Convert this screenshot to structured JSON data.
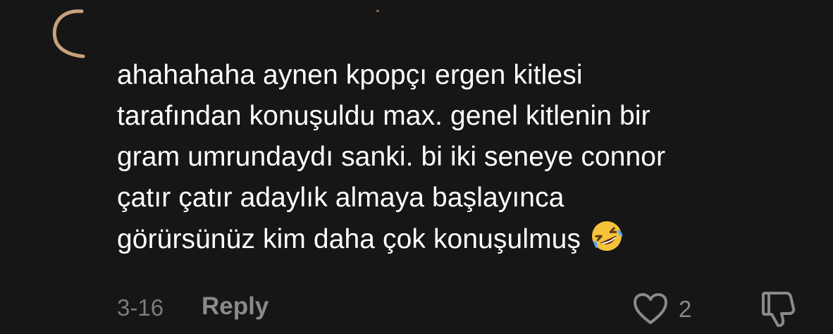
{
  "comment": {
    "lines": [
      "ahahahaha aynen kpopçı ergen kitlesi",
      "tarafından konuşuldu max. genel kitlenin bir",
      "gram umrundaydı sanki. bi iki seneye connor",
      "çatır çatır adaylık almaya başlayınca",
      "görürsünüz kim daha çok konuşulmuş"
    ],
    "emoji": "rolling-on-the-floor-laughing-icon",
    "timestamp": "3-16",
    "reply_label": "Reply",
    "like_count": "2"
  },
  "icons": {
    "like": "heart-outline-icon",
    "dislike": "thumbs-down-outline-icon"
  },
  "colors": {
    "background": "#161616",
    "text": "#ffffff",
    "meta": "#7c7c7c",
    "action": "#8a8a8a",
    "emoji": "#f5c33b"
  }
}
